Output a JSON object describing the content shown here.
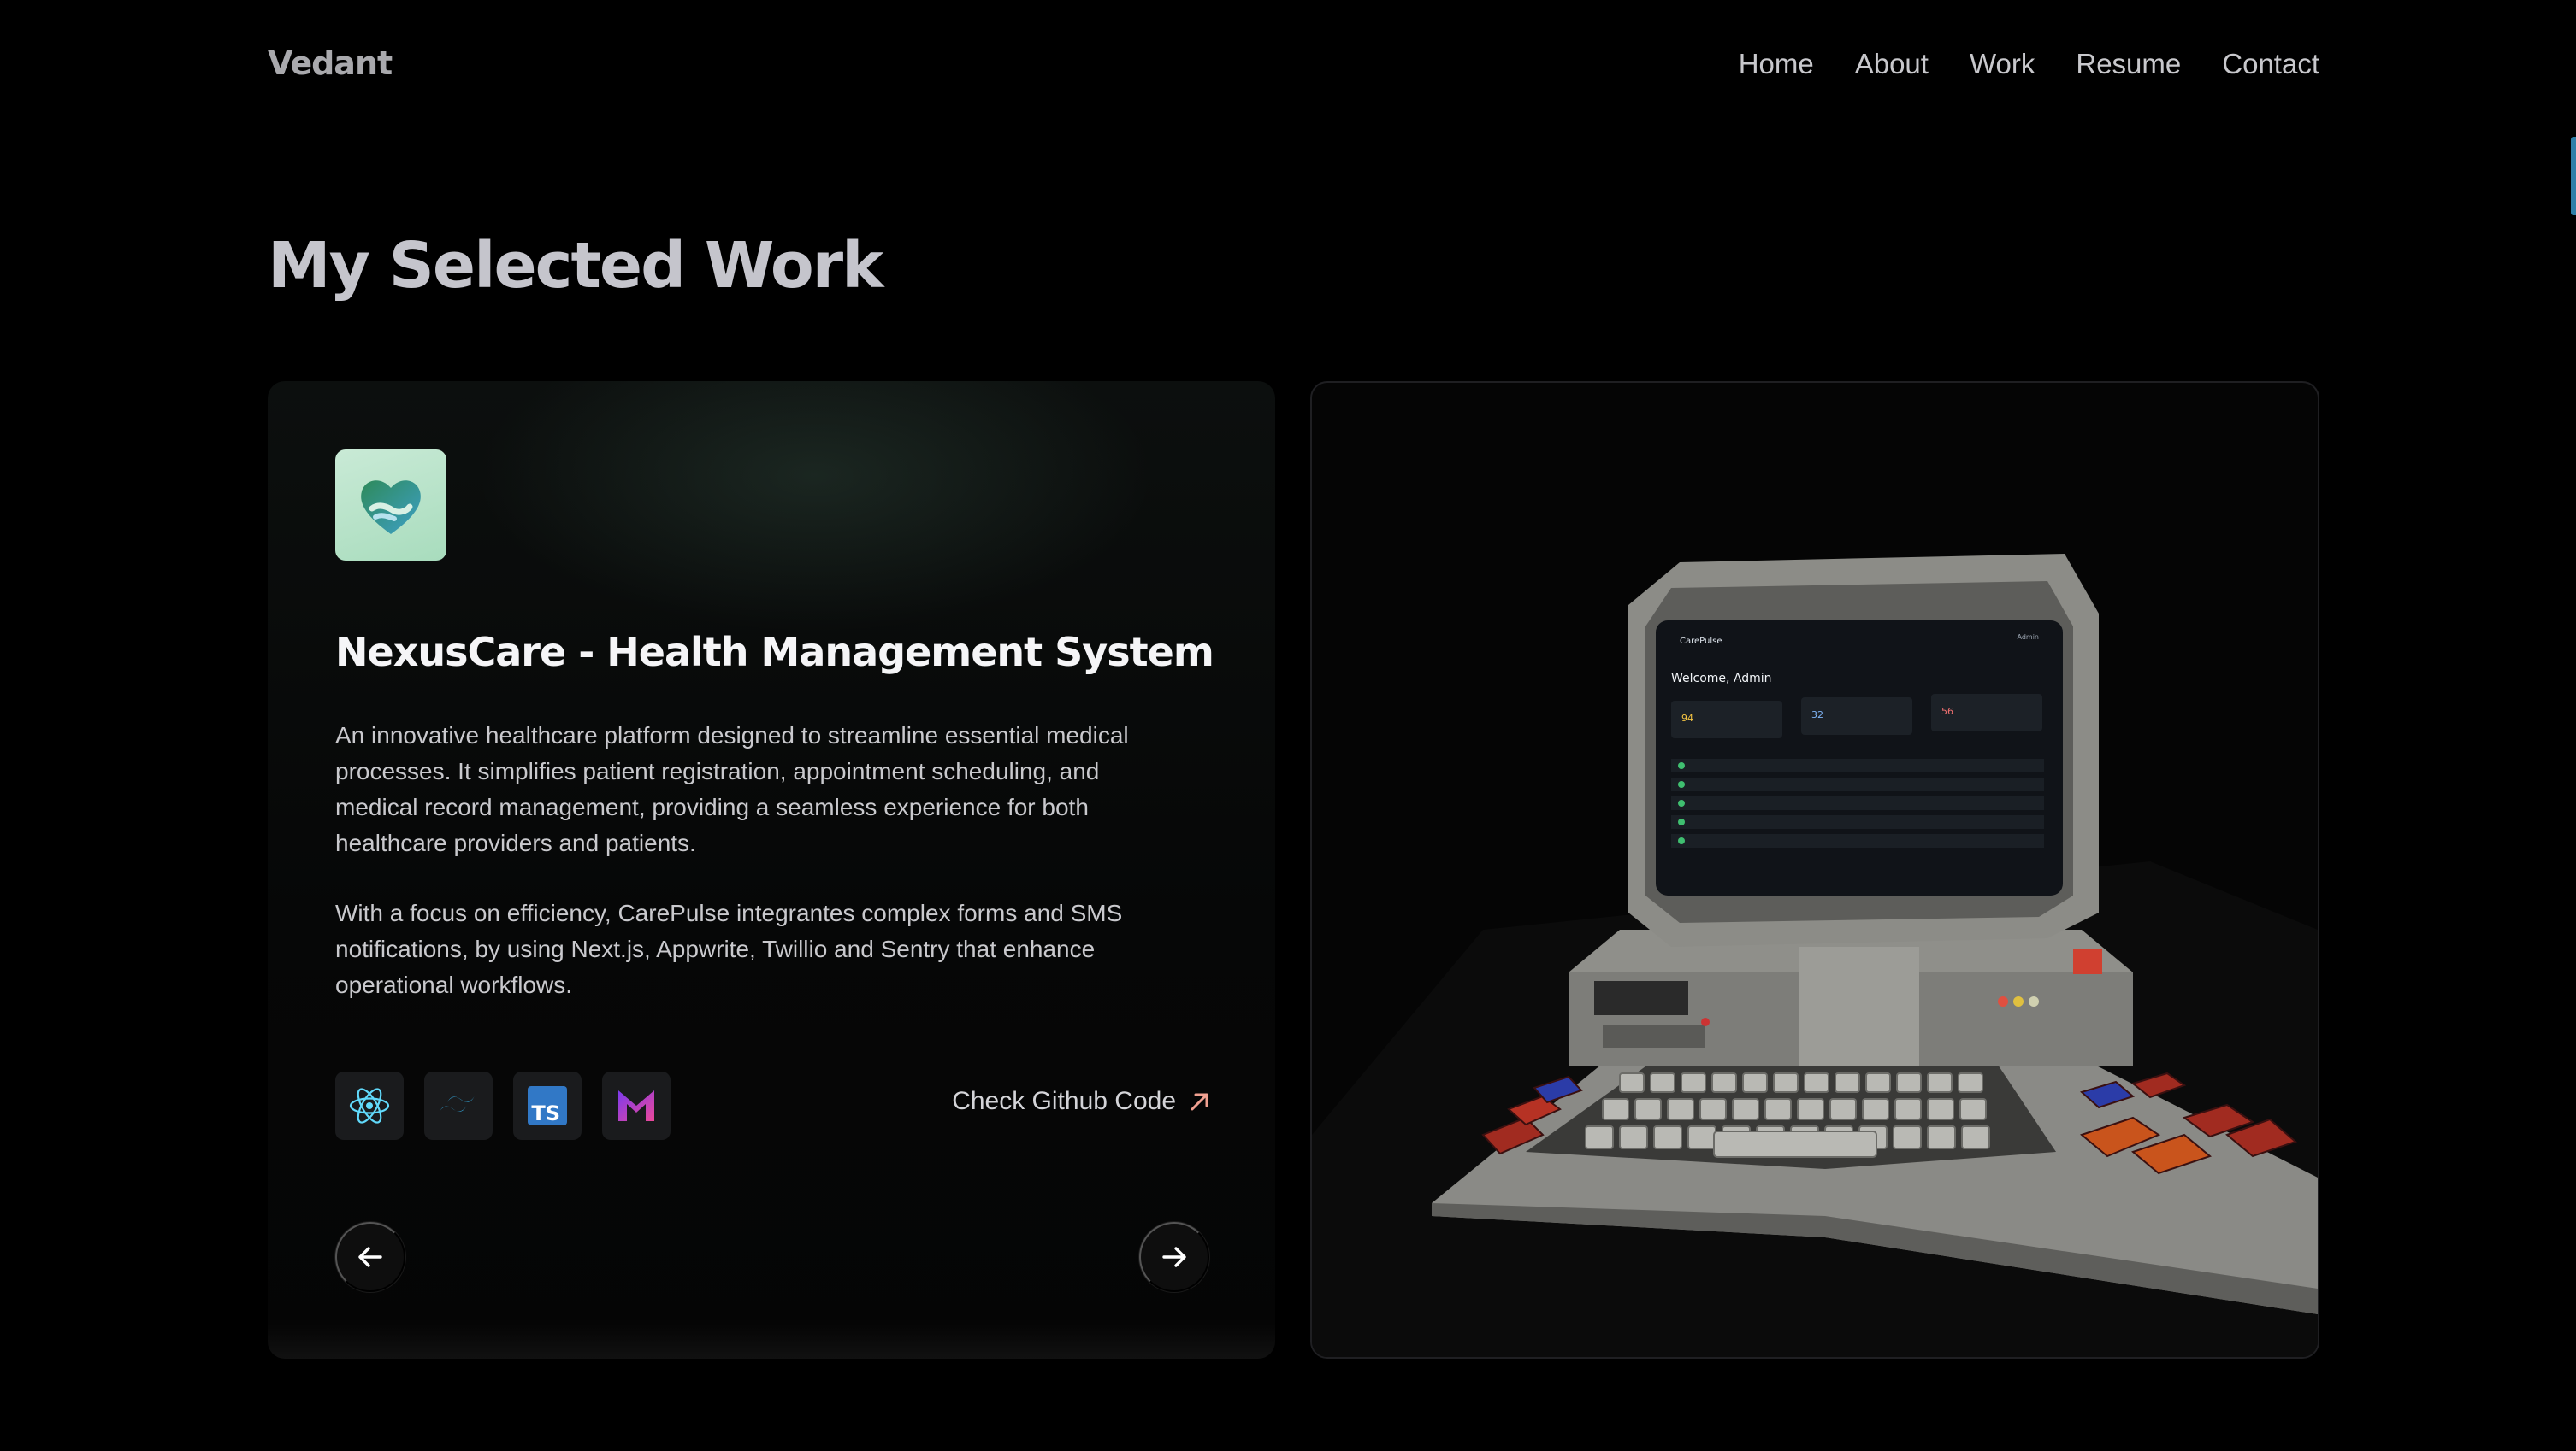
{
  "brand": {
    "name": "Vedant"
  },
  "nav": {
    "items": [
      "Home",
      "About",
      "Work",
      "Resume",
      "Contact"
    ]
  },
  "page": {
    "heading": "My Selected Work"
  },
  "project": {
    "title": "NexusCare - Health Management System",
    "description_1": "An innovative healthcare platform designed to streamline essential medical processes. It simplifies patient registration, appointment scheduling, and medical record management, providing a seamless experience for both healthcare providers and patients.",
    "description_2": "With a focus on efficiency, CarePulse integrantes complex forms and SMS notifications, by using Next.js, Appwrite, Twillio and Sentry that enhance operational workflows.",
    "tech_icons": [
      "react-icon",
      "tailwind-icon",
      "typescript-icon",
      "mui-icon"
    ],
    "github_label": "Check Github Code",
    "app_icon": "heart-hands-logo"
  },
  "preview": {
    "screen": {
      "brand": "CarePulse",
      "user": "Admin",
      "welcome": "Welcome, Admin",
      "stats": [
        {
          "value": "94"
        },
        {
          "value": "32"
        },
        {
          "value": "56"
        }
      ]
    }
  },
  "carousel": {
    "prev_icon": "arrow-left-icon",
    "next_icon": "arrow-right-icon"
  },
  "colors": {
    "background": "#000000",
    "heading": "#c5c5cc",
    "nav_text": "#c8c8cc",
    "github_arrow": "#f0a090",
    "icon_bg": "#1a1b1d"
  }
}
